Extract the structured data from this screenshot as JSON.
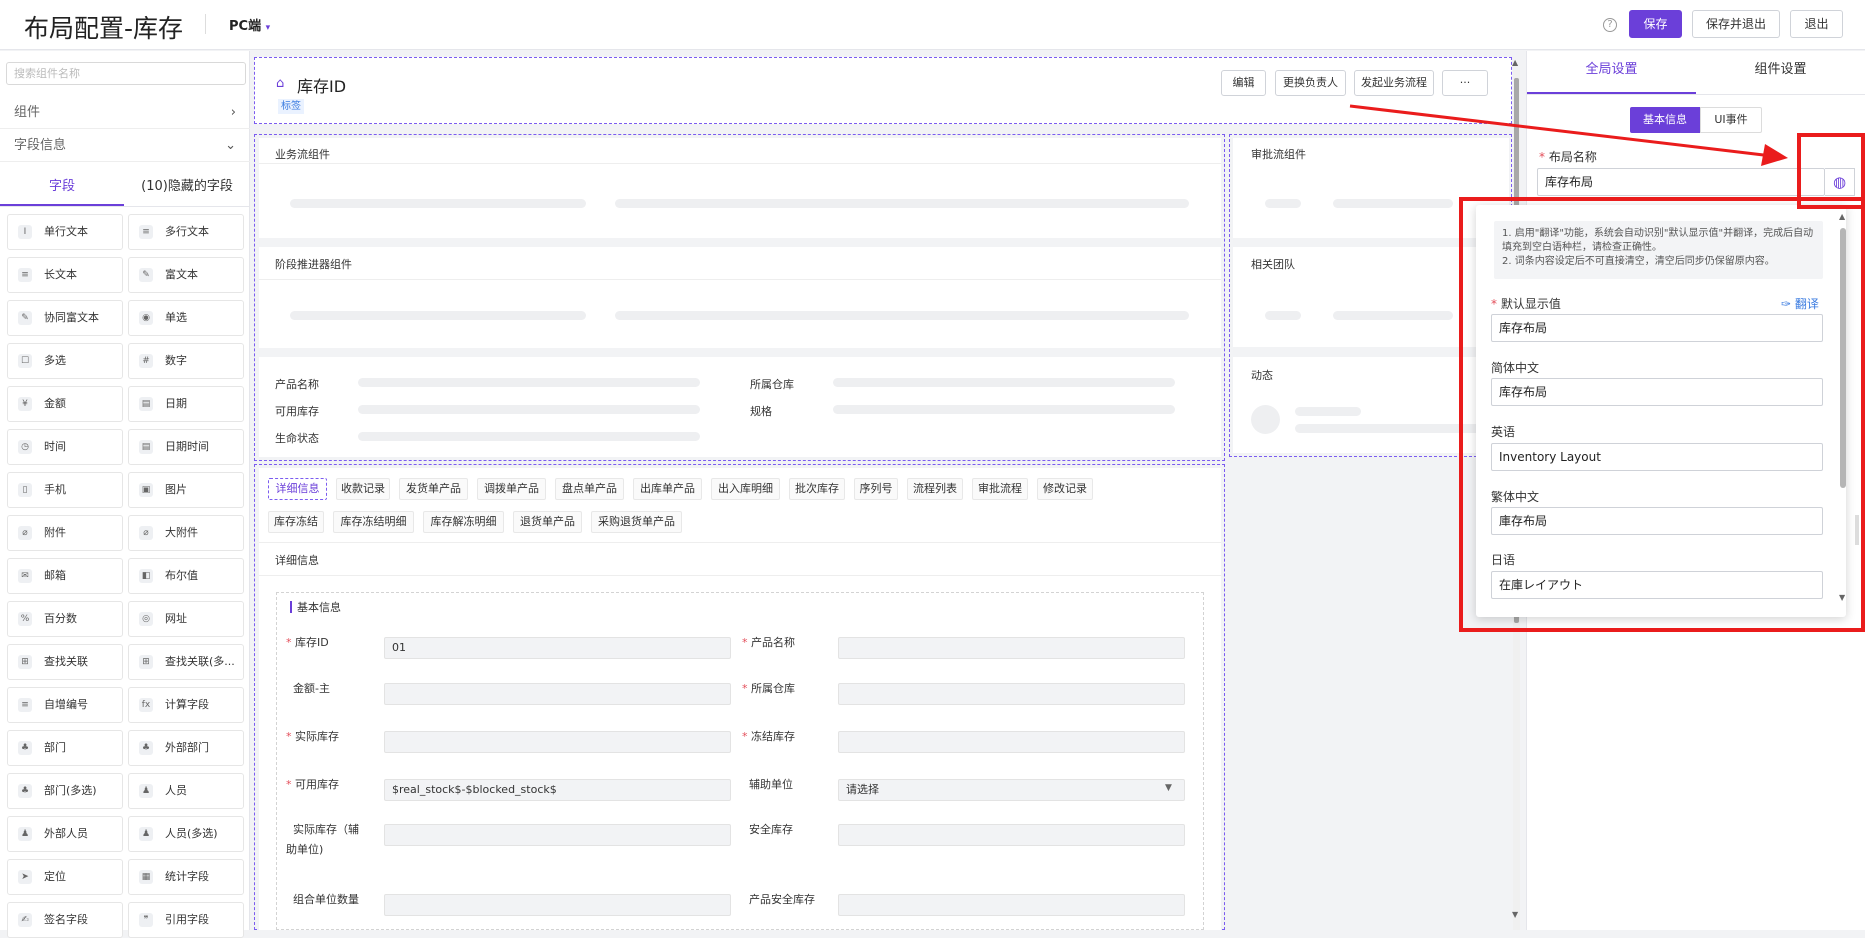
{
  "header": {
    "title": "布局配置-库存",
    "platform": "PC端",
    "help_icon": "question-circle-icon",
    "save": "保存",
    "save_exit": "保存并退出",
    "exit": "退出"
  },
  "left": {
    "search_placeholder": "搜索组件名称",
    "components": "组件",
    "field_info": "字段信息",
    "tab_fields": "字段",
    "tab_hidden": "(10)隐藏的字段",
    "fields": [
      {
        "icon": "I",
        "label": "单行文本"
      },
      {
        "icon": "≡",
        "label": "多行文本"
      },
      {
        "icon": "≡",
        "label": "长文本"
      },
      {
        "icon": "✎",
        "label": "富文本"
      },
      {
        "icon": "✎",
        "label": "协同富文本"
      },
      {
        "icon": "◉",
        "label": "单选"
      },
      {
        "icon": "☐",
        "label": "多选"
      },
      {
        "icon": "#",
        "label": "数字"
      },
      {
        "icon": "¥",
        "label": "金额"
      },
      {
        "icon": "▤",
        "label": "日期"
      },
      {
        "icon": "◷",
        "label": "时间"
      },
      {
        "icon": "▤",
        "label": "日期时间"
      },
      {
        "icon": "▯",
        "label": "手机"
      },
      {
        "icon": "▣",
        "label": "图片"
      },
      {
        "icon": "⌀",
        "label": "附件"
      },
      {
        "icon": "⌀",
        "label": "大附件"
      },
      {
        "icon": "✉",
        "label": "邮箱"
      },
      {
        "icon": "◧",
        "label": "布尔值"
      },
      {
        "icon": "%",
        "label": "百分数"
      },
      {
        "icon": "◎",
        "label": "网址"
      },
      {
        "icon": "⊞",
        "label": "查找关联"
      },
      {
        "icon": "⊞",
        "label": "查找关联(多..."
      },
      {
        "icon": "≡",
        "label": "自增编号"
      },
      {
        "icon": "fx",
        "label": "计算字段"
      },
      {
        "icon": "♣",
        "label": "部门"
      },
      {
        "icon": "♣",
        "label": "外部部门"
      },
      {
        "icon": "♣",
        "label": "部门(多选)"
      },
      {
        "icon": "♟",
        "label": "人员"
      },
      {
        "icon": "♟",
        "label": "外部人员"
      },
      {
        "icon": "♟",
        "label": "人员(多选)"
      },
      {
        "icon": "➤",
        "label": "定位"
      },
      {
        "icon": "▦",
        "label": "统计字段"
      },
      {
        "icon": "✍",
        "label": "签名字段"
      },
      {
        "icon": "❞",
        "label": "引用字段"
      }
    ]
  },
  "canvas": {
    "record_title": "库存ID",
    "tag": "标签",
    "actions": [
      "编辑",
      "更换负责人",
      "发起业务流程",
      "···"
    ],
    "business_flow": "业务流组件",
    "stage_advancer": "阶段推进器组件",
    "approval_flow": "审批流组件",
    "related_team": "相关团队",
    "activity": "动态",
    "summary_fields": [
      "产品名称",
      "所属仓库",
      "可用库存",
      "规格",
      "生命状态"
    ],
    "tabs": [
      "详细信息",
      "收款记录",
      "发货单产品",
      "调拨单产品",
      "盘点单产品",
      "出库单产品",
      "出入库明细",
      "批次库存",
      "序列号",
      "流程列表",
      "审批流程",
      "修改记录",
      "库存冻结",
      "库存冻结明细",
      "库存解冻明细",
      "退货单产品",
      "采购退货单产品"
    ],
    "detail_title": "详细信息",
    "basic_info": "基本信息",
    "form": [
      {
        "label": "库存ID",
        "required": true,
        "value": "01"
      },
      {
        "label": "产品名称",
        "required": true,
        "value": ""
      },
      {
        "label": "金额-主",
        "required": false,
        "value": ""
      },
      {
        "label": "所属仓库",
        "required": true,
        "value": ""
      },
      {
        "label": "实际库存",
        "required": true,
        "value": ""
      },
      {
        "label": "冻结库存",
        "required": true,
        "value": ""
      },
      {
        "label": "可用库存",
        "required": true,
        "value": "$real_stock$-$blocked_stock$"
      },
      {
        "label": "辅助单位",
        "required": false,
        "value": "请选择"
      },
      {
        "label": "实际库存（辅助单位)",
        "required": false,
        "value": ""
      },
      {
        "label": "安全库存",
        "required": false,
        "value": ""
      },
      {
        "label": "组合单位数量",
        "required": false,
        "value": ""
      },
      {
        "label": "产品安全库存",
        "required": false,
        "value": ""
      }
    ]
  },
  "right": {
    "tab_global": "全局设置",
    "tab_component": "组件设置",
    "pill_basic": "基本信息",
    "pill_ui": "UI事件",
    "layout_name_label": "布局名称",
    "layout_name_value": "库存布局",
    "translate_icon": "globe-icon"
  },
  "popup": {
    "notice_1": "1. 启用\"翻译\"功能，系统会自动识别\"默认显示值\"并翻译，完成后自动填充到空白语种栏，请检查正确性。",
    "notice_2": "2. 词条内容设定后不可直接清空，清空后同步仍保留原内容。",
    "default_label": "默认显示值",
    "translate": "翻译",
    "default_value": "库存布局",
    "langs": [
      {
        "label": "简体中文",
        "value": "库存布局"
      },
      {
        "label": "英语",
        "value": "Inventory Layout"
      },
      {
        "label": "繁体中文",
        "value": "庫存布局"
      },
      {
        "label": "日语",
        "value": "在庫レイアウト"
      }
    ]
  },
  "colors": {
    "accent": "#6b3fd9",
    "annotation": "#ea1c1c"
  }
}
